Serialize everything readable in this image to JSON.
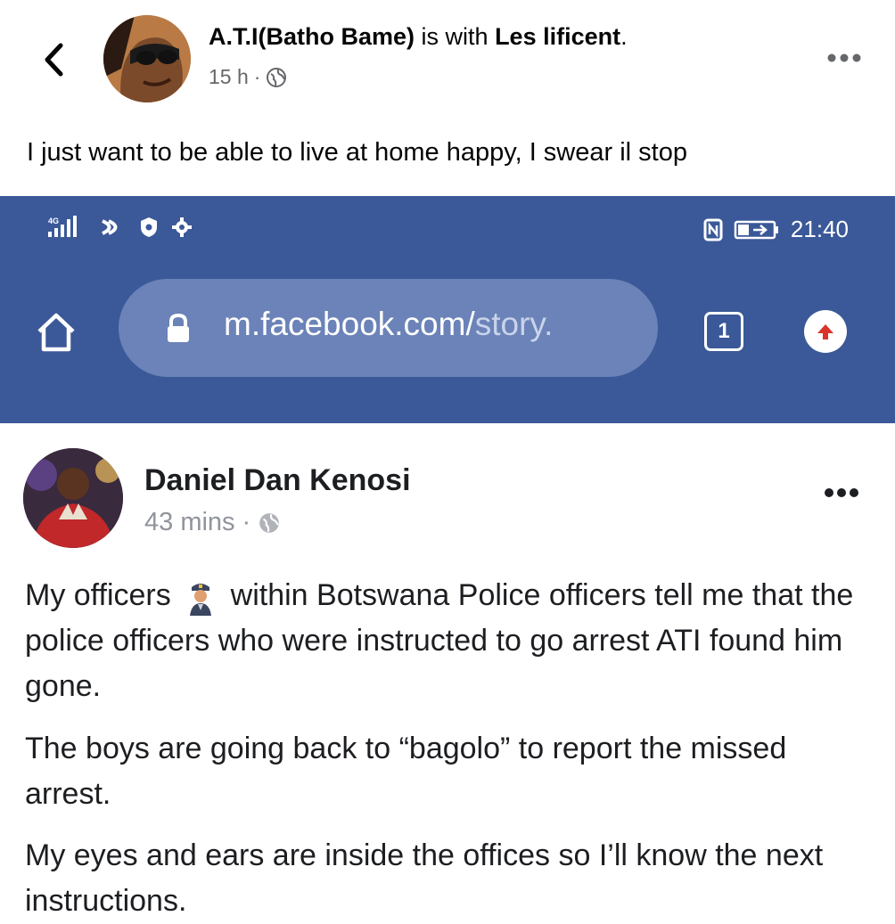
{
  "post": {
    "author": "A.T.I(Batho Bame)",
    "with_text": " is with ",
    "tagged": "Les lificent",
    "period": ".",
    "time": "15 h",
    "dot": "·",
    "caption": "I just want to be able to live at home happy, I swear il stop"
  },
  "screenshot": {
    "status": {
      "network": "4G",
      "time": "21:40"
    },
    "browser": {
      "url_main": "m.facebook.com/",
      "url_rest": "story.",
      "tab_count": "1"
    },
    "inner_post": {
      "author": "Daniel Dan Kenosi",
      "time": "43 mins",
      "dot": "·",
      "para1_a": "My officers",
      "para1_b": "within Botswana Police officers tell me that the police officers who were instructed to go arrest ATI found him gone.",
      "para2": "The boys are going back to “bagolo” to report the missed arrest.",
      "para3": "My eyes and ears are inside the offices so I’ll know the next instructions."
    }
  },
  "colors": {
    "browser_bar": "#3b5998",
    "url_pill": "#6b83b8",
    "meta_gray": "#65676b"
  },
  "icons": [
    "back-arrow-icon",
    "globe-icon",
    "more-icon",
    "signal-icon",
    "cast-icon",
    "shield-icon",
    "settings-icon",
    "nfc-icon",
    "battery-icon",
    "home-icon",
    "lock-icon",
    "tabs-icon",
    "upload-icon",
    "police-officer-emoji"
  ]
}
